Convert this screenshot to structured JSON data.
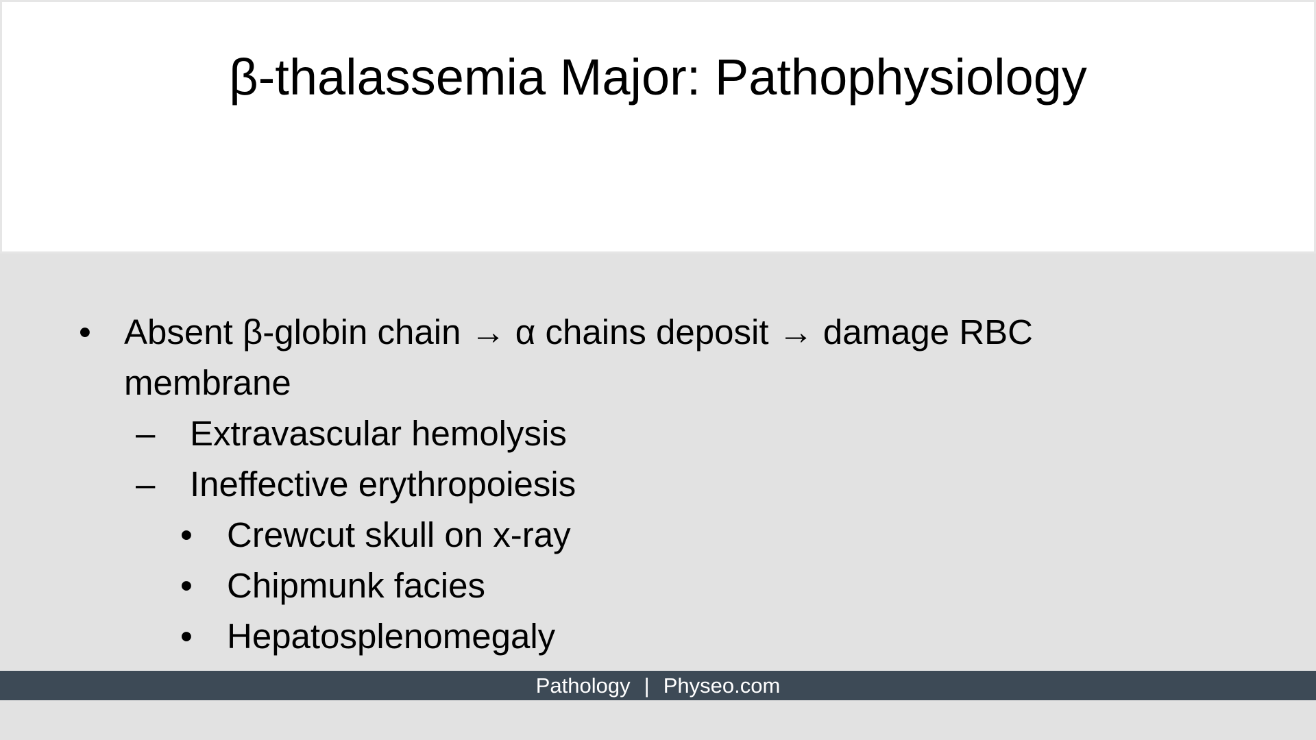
{
  "slide": {
    "title": "β-thalassemia Major: Pathophysiology",
    "bullets": [
      {
        "text": "Absent β-globin chain → α chains deposit → damage RBC membrane",
        "sub": [
          {
            "text": "Extravascular hemolysis"
          },
          {
            "text": "Ineffective erythropoiesis",
            "sub": [
              {
                "text": "Crewcut skull on x-ray"
              },
              {
                "text": "Chipmunk facies"
              },
              {
                "text": "Hepatosplenomegaly"
              }
            ]
          }
        ]
      }
    ],
    "markers": {
      "level1": "•",
      "level2": "–",
      "level3": "•"
    }
  },
  "footer": {
    "left": "Pathology",
    "separator": "|",
    "right": "Physeo.com"
  },
  "colors": {
    "title_background": "#ffffff",
    "body_background": "#e2e2e2",
    "footer_background": "#3d4a56",
    "footer_text": "#ffffff"
  }
}
